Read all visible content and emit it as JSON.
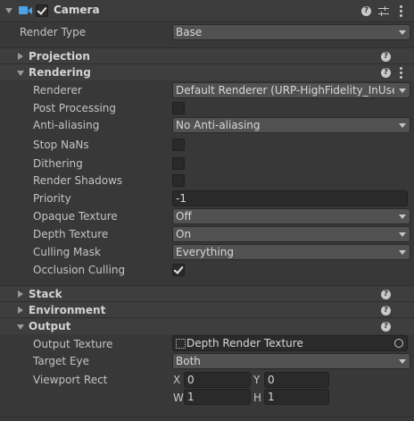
{
  "header": {
    "title": "Camera",
    "enabled": true
  },
  "render_type": {
    "label": "Render Type",
    "value": "Base"
  },
  "sections": {
    "projection": "Projection",
    "rendering": "Rendering",
    "stack": "Stack",
    "environment": "Environment",
    "output": "Output"
  },
  "rendering": {
    "renderer": {
      "label": "Renderer",
      "value": "Default Renderer (URP-HighFidelity_InUse-I"
    },
    "post_processing": {
      "label": "Post Processing",
      "checked": false
    },
    "anti_aliasing": {
      "label": "Anti-aliasing",
      "value": "No Anti-aliasing"
    },
    "stop_nans": {
      "label": "Stop NaNs",
      "checked": false
    },
    "dithering": {
      "label": "Dithering",
      "checked": false
    },
    "render_shadows": {
      "label": "Render Shadows",
      "checked": false
    },
    "priority": {
      "label": "Priority",
      "value": "-1"
    },
    "opaque_texture": {
      "label": "Opaque Texture",
      "value": "Off"
    },
    "depth_texture": {
      "label": "Depth Texture",
      "value": "On"
    },
    "culling_mask": {
      "label": "Culling Mask",
      "value": "Everything"
    },
    "occlusion_culling": {
      "label": "Occlusion Culling",
      "checked": true
    }
  },
  "output": {
    "output_texture": {
      "label": "Output Texture",
      "value": "Depth Render Texture"
    },
    "target_eye": {
      "label": "Target Eye",
      "value": "Both"
    },
    "viewport_rect": {
      "label": "Viewport Rect",
      "x_label": "X",
      "x": "0",
      "y_label": "Y",
      "y": "0",
      "w_label": "W",
      "w": "1",
      "h_label": "H",
      "h": "1"
    }
  },
  "icons": {
    "help": "?"
  },
  "colors": {
    "background": "#383838",
    "field": "#515151",
    "section_header": "#3e3e3e",
    "camera_icon": "#4aa3e8"
  }
}
